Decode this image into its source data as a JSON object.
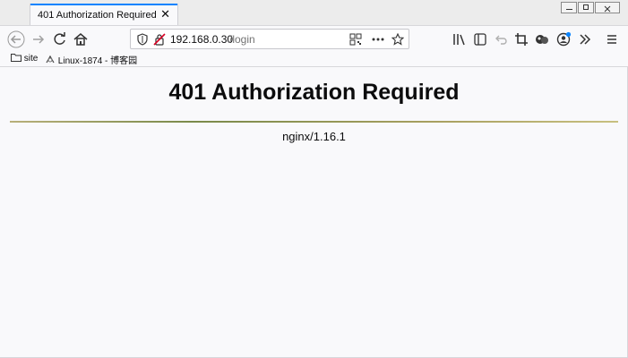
{
  "tab": {
    "title": "401 Authorization Required",
    "close": "✕"
  },
  "address": {
    "host": "192.168.0.30",
    "path": "/login"
  },
  "bookmarks": [
    {
      "label": "site",
      "icon": "folder-icon"
    },
    {
      "label": "Linux-1874 - 博客园",
      "icon": "site-favicon-icon"
    }
  ],
  "page": {
    "heading": "401 Authorization Required",
    "server": "nginx/1.16.1"
  },
  "colors": {
    "accent": "#0a84ff",
    "insecure": "#d70022",
    "badge_blue": "#0a84ff"
  }
}
